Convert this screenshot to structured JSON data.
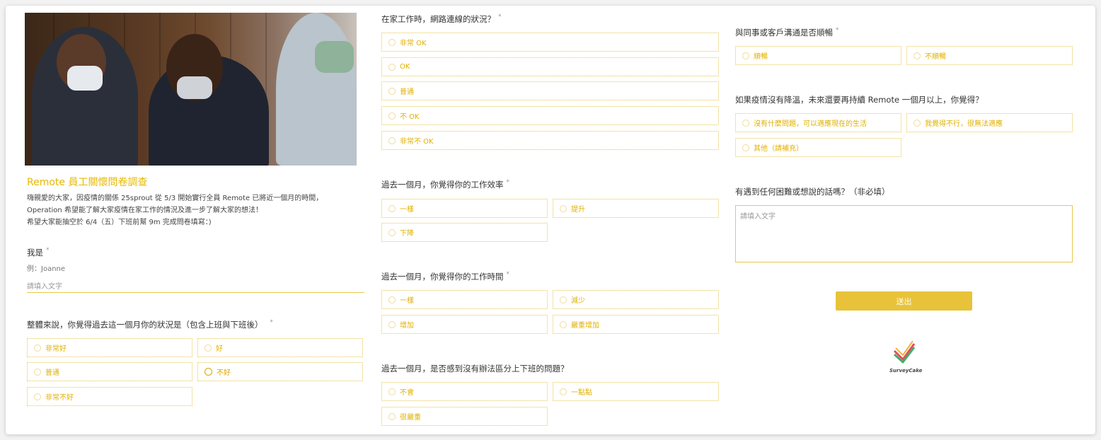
{
  "header": {
    "title": "Remote 員工關懷問卷調查",
    "intro_lines": [
      "嗨親愛的大家，因疫情的關係 25sprout 從 5/3 開始實行全員 Remote 已將近一個月的時間，",
      "Operation 希望能了解大家疫情在家工作的情況及進一步了解大家的想法！",
      "希望大家能抽空於 6/4（五）下班前幫 9m 完成問卷填寫：)"
    ]
  },
  "name_question": {
    "label": "我是",
    "required_mark": "*",
    "hint": "例：Joanne",
    "placeholder": "請填入文字"
  },
  "q_overall": {
    "label": "整體來說，你覺得過去這一個月你的狀況是（包含上班與下班後）",
    "required_mark": "*",
    "options": [
      "非常好",
      "好",
      "普通",
      "不好",
      "非常不好"
    ],
    "selected": "不好"
  },
  "q_network": {
    "label": "在家工作時，網路連線的狀況？",
    "required_mark": "*",
    "options": [
      "非常 OK",
      "OK",
      "普通",
      "不 OK",
      "非常不 OK"
    ]
  },
  "q_efficiency": {
    "label": "過去一個月，你覺得你的工作效率",
    "required_mark": "*",
    "options": [
      "一樣",
      "提升",
      "下降"
    ]
  },
  "q_hours": {
    "label": "過去一個月，你覺得你的工作時間",
    "required_mark": "*",
    "options": [
      "一樣",
      "減少",
      "增加",
      "嚴重增加"
    ]
  },
  "q_boundary": {
    "label": "過去一個月，是否感到沒有辦法區分上下班的問題？",
    "options": [
      "不會",
      "一點點",
      "很嚴重"
    ]
  },
  "q_communication": {
    "label": "與同事或客戶溝通是否順暢",
    "required_mark": "*",
    "options": [
      "順暢",
      "不順暢"
    ]
  },
  "q_continue": {
    "label": "如果疫情沒有降溫，未來還要再持續 Remote 一個月以上，你覺得？",
    "options": [
      "沒有什麼問題，可以適應現在的生活",
      "我覺得不行，很無法適應",
      "其他（請補充）"
    ]
  },
  "q_feedback": {
    "label": "有遇到任何困難或想說的話嗎？（非必填）",
    "placeholder": "請填入文字"
  },
  "submit": {
    "label": "送出"
  },
  "brand": {
    "name": "SurveyCake"
  },
  "colors": {
    "accent": "#e8c33a",
    "title": "#e6b800"
  }
}
